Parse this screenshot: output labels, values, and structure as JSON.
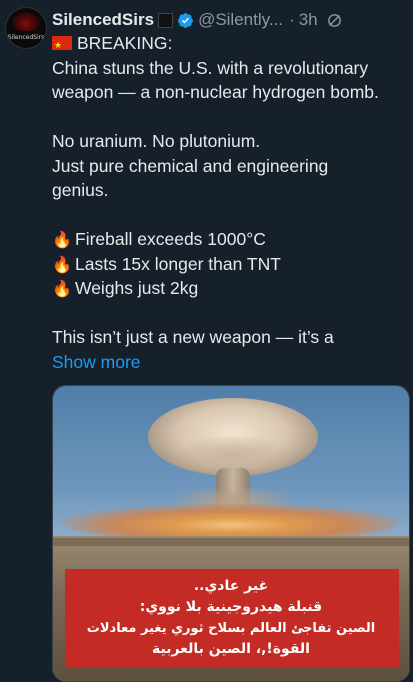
{
  "author": {
    "name": "SilencedSirs",
    "handle": "@Silently...",
    "separator": "·",
    "time": "3h",
    "avatar_text": "SilencedSirs"
  },
  "icons": {
    "verified": "verified-badge-icon",
    "grok": "grok-icon",
    "flag": "china-flag-icon",
    "fire": "fire-icon"
  },
  "colors": {
    "background": "#15202b",
    "link": "#1d9bf0",
    "secondary_text": "#8b98a5",
    "caption_bg": "#c42b25"
  },
  "post": {
    "breaking": "BREAKING:",
    "line1": "China stuns the U.S. with a revolutionary",
    "line2": "weapon — a non-nuclear hydrogen bomb.",
    "line3": "No uranium. No plutonium.",
    "line4": "Just pure chemical and engineering",
    "line5": "genius.",
    "bullet1": "Fireball exceeds 1000°C",
    "bullet2": "Lasts 15x longer than TNT",
    "bullet3": "Weighs just 2kg",
    "line6": "This isn’t just a new weapon — it’s a",
    "show_more": "Show more"
  },
  "media": {
    "caption_lines": [
      "غير عادي..",
      "قنبلة هيدروجينية بلا نووي:",
      "الصين تفاجئ العالم بسلاح ثوري يغير معادلات",
      "القوة!,، الصين بالعربية"
    ]
  }
}
